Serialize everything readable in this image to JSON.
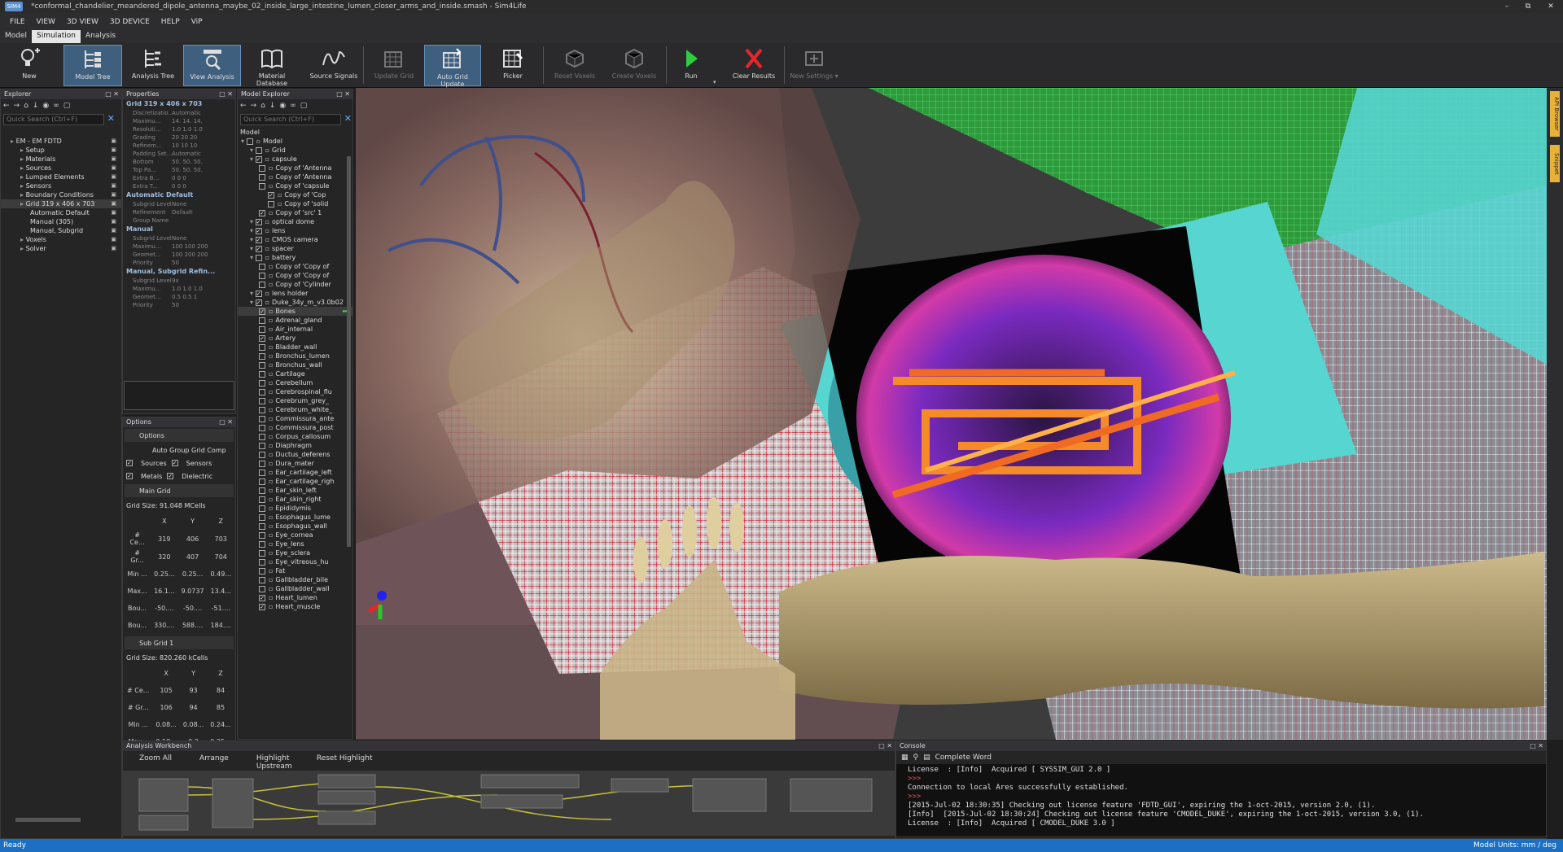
{
  "window": {
    "logo_text": "SIM4",
    "title": "*conformal_chandelier_meandered_dipole_antenna_maybe_02_inside_large_intestine_lumen_closer_arms_and_inside.smash - Sim4Life"
  },
  "menu": [
    "FILE",
    "VIEW",
    "3D VIEW",
    "3D DEVICE",
    "HELP",
    "ViP"
  ],
  "tabs": [
    "Model",
    "Simulation",
    "Analysis"
  ],
  "ribbon": {
    "new": "New",
    "model_tree": "Model Tree",
    "analysis_tree": "Analysis Tree",
    "view_analysis": "View Analysis",
    "material_database": "Material Database",
    "source_signals": "Source Signals",
    "update_grid": "Update Grid",
    "auto_grid_update": "Auto Grid Update",
    "picker": "Picker",
    "reset_voxels": "Reset Voxels",
    "create_voxels": "Create Voxels",
    "run": "Run",
    "clear_results": "Clear Results",
    "new_settings": "New Settings"
  },
  "explorer": {
    "title": "Explorer",
    "search_placeholder": "Quick Search (Ctrl+F)",
    "items": [
      {
        "label": "EM - EM FDTD",
        "indent": 0
      },
      {
        "label": "Setup",
        "indent": 1
      },
      {
        "label": "Materials",
        "indent": 1
      },
      {
        "label": "Sources",
        "indent": 1
      },
      {
        "label": "Lumped Elements",
        "indent": 1
      },
      {
        "label": "Sensors",
        "indent": 1
      },
      {
        "label": "Boundary Conditions",
        "indent": 1
      },
      {
        "label": "Grid 319 x 406 x 703",
        "indent": 1
      },
      {
        "label": "Automatic Default",
        "indent": 2
      },
      {
        "label": "Manual (305)",
        "indent": 2
      },
      {
        "label": "Manual, Subgrid",
        "indent": 2
      },
      {
        "label": "Voxels",
        "indent": 1
      },
      {
        "label": "Solver",
        "indent": 1
      }
    ]
  },
  "properties": {
    "title": "Properties",
    "header": "Grid 319 x 406 x 703",
    "rows1": [
      {
        "k": "Discretizatio...",
        "v": "Automatic"
      },
      {
        "k": "Maximu...",
        "v": "14.   14.   14."
      },
      {
        "k": "Resoluti...",
        "v": "1.0   1.0   1.0"
      },
      {
        "k": "Grading",
        "v": "20    20    20"
      },
      {
        "k": "Refinem...",
        "v": "10    10    10"
      },
      {
        "k": "Padding Set...",
        "v": "Automatic"
      },
      {
        "k": "Bottom",
        "v": "50.   50.   50."
      },
      {
        "k": "Top Pa...",
        "v": "50.   50.   50."
      },
      {
        "k": "Extra B...",
        "v": "0      0      0"
      },
      {
        "k": "Extra T...",
        "v": "0      0      0"
      }
    ],
    "sec2": "Automatic Default",
    "rows2": [
      {
        "k": "Subgrid Level",
        "v": "None"
      },
      {
        "k": "Refinement",
        "v": "Default"
      },
      {
        "k": "Group Name",
        "v": ""
      }
    ],
    "sec3": "Manual",
    "rows3": [
      {
        "k": "Subgrid Level",
        "v": "None"
      },
      {
        "k": "Maximu...",
        "v": "100   100   200"
      },
      {
        "k": "Geomet...",
        "v": "100   200   200"
      },
      {
        "k": "Priority",
        "v": "50"
      }
    ],
    "sec4": "Manual, Subgrid Refin...",
    "rows4": [
      {
        "k": "Subgrid Level",
        "v": "9x"
      },
      {
        "k": "Maximu...",
        "v": "1.0   1.0   1.0"
      },
      {
        "k": "Geomet...",
        "v": "0.5   0.5   1"
      },
      {
        "k": "Priority",
        "v": "50"
      }
    ]
  },
  "options": {
    "title": "Options",
    "header": "Options",
    "auto_group": "Auto Group Grid Comp",
    "sources": "Sources",
    "sensors": "Sensors",
    "metals": "Metals",
    "dielectric": "Dielectric",
    "main_grid": "Main Grid",
    "main_grid_size": "Grid Size: 91.048 MCells",
    "cols": [
      "X",
      "Y",
      "Z"
    ],
    "main_rows": [
      [
        "# Ce...",
        "319",
        "406",
        "703"
      ],
      [
        "# Gr...",
        "320",
        "407",
        "704"
      ],
      [
        "Min ...",
        "0.25...",
        "0.25...",
        "0.49..."
      ],
      [
        "Max...",
        "16.1...",
        "9.0737",
        "13.4..."
      ],
      [
        "Bou...",
        "-50....",
        "-50....",
        "-51...."
      ],
      [
        "Bou...",
        "330....",
        "588....",
        "184...."
      ]
    ],
    "sub_grid": "Sub Grid 1",
    "sub_grid_size": "Grid Size: 820.260 kCells",
    "sub_rows": [
      [
        "# Ce...",
        "105",
        "93",
        "84"
      ],
      [
        "# Gr...",
        "106",
        "94",
        "85"
      ],
      [
        "Min ...",
        "0.08...",
        "0.08...",
        "0.24..."
      ],
      [
        "Max...",
        "0.18...",
        "0.2",
        "0.25..."
      ]
    ]
  },
  "model_explorer": {
    "title": "Model Explorer",
    "search_placeholder": "Quick Search (Ctrl+F)",
    "root_label": "Model",
    "items": [
      {
        "label": "Model",
        "indent": 0,
        "checked": false
      },
      {
        "label": "Grid",
        "indent": 1,
        "checked": false
      },
      {
        "label": "capsule",
        "indent": 1,
        "checked": true
      },
      {
        "label": "Copy of 'Antenna",
        "indent": 2,
        "checked": false
      },
      {
        "label": "Copy of 'Antenna",
        "indent": 2,
        "checked": false
      },
      {
        "label": "Copy of 'capsule",
        "indent": 2,
        "checked": false
      },
      {
        "label": "Copy of 'Cop",
        "indent": 3,
        "checked": true
      },
      {
        "label": "Copy of 'solid",
        "indent": 3,
        "checked": false
      },
      {
        "label": "Copy of 'src' 1",
        "indent": 2,
        "checked": true
      },
      {
        "label": "optical dome",
        "indent": 1,
        "checked": true
      },
      {
        "label": "lens",
        "indent": 1,
        "checked": true
      },
      {
        "label": "CMOS camera",
        "indent": 1,
        "checked": true
      },
      {
        "label": "spacer",
        "indent": 1,
        "checked": true
      },
      {
        "label": "battery",
        "indent": 1,
        "checked": false
      },
      {
        "label": "Copy of 'Copy of",
        "indent": 2,
        "checked": false
      },
      {
        "label": "Copy of 'Copy of",
        "indent": 2,
        "checked": false
      },
      {
        "label": "Copy of 'Cylinder",
        "indent": 2,
        "checked": false
      },
      {
        "label": "lens holder",
        "indent": 1,
        "checked": true
      },
      {
        "label": "Duke_34y_m_v3.0b02",
        "indent": 1,
        "checked": true
      },
      {
        "label": "Bones",
        "indent": 2,
        "checked": true
      },
      {
        "label": "Adrenal_gland",
        "indent": 2,
        "checked": false
      },
      {
        "label": "Air_internal",
        "indent": 2,
        "checked": false
      },
      {
        "label": "Artery",
        "indent": 2,
        "checked": true
      },
      {
        "label": "Bladder_wall",
        "indent": 2,
        "checked": false
      },
      {
        "label": "Bronchus_lumen",
        "indent": 2,
        "checked": false
      },
      {
        "label": "Bronchus_wall",
        "indent": 2,
        "checked": false
      },
      {
        "label": "Cartilage",
        "indent": 2,
        "checked": false
      },
      {
        "label": "Cerebellum",
        "indent": 2,
        "checked": false
      },
      {
        "label": "Cerebrospinal_flu",
        "indent": 2,
        "checked": false
      },
      {
        "label": "Cerebrum_grey_",
        "indent": 2,
        "checked": false
      },
      {
        "label": "Cerebrum_white_",
        "indent": 2,
        "checked": false
      },
      {
        "label": "Commissura_ante",
        "indent": 2,
        "checked": false
      },
      {
        "label": "Commissura_post",
        "indent": 2,
        "checked": false
      },
      {
        "label": "Corpus_callosum",
        "indent": 2,
        "checked": false
      },
      {
        "label": "Diaphragm",
        "indent": 2,
        "checked": false
      },
      {
        "label": "Ductus_deferens",
        "indent": 2,
        "checked": false
      },
      {
        "label": "Dura_mater",
        "indent": 2,
        "checked": false
      },
      {
        "label": "Ear_cartilage_left",
        "indent": 2,
        "checked": false
      },
      {
        "label": "Ear_cartilage_righ",
        "indent": 2,
        "checked": false
      },
      {
        "label": "Ear_skin_left",
        "indent": 2,
        "checked": false
      },
      {
        "label": "Ear_skin_right",
        "indent": 2,
        "checked": false
      },
      {
        "label": "Epididymis",
        "indent": 2,
        "checked": false
      },
      {
        "label": "Esophagus_lume",
        "indent": 2,
        "checked": false
      },
      {
        "label": "Esophagus_wall",
        "indent": 2,
        "checked": false
      },
      {
        "label": "Eye_cornea",
        "indent": 2,
        "checked": false
      },
      {
        "label": "Eye_lens",
        "indent": 2,
        "checked": false
      },
      {
        "label": "Eye_sclera",
        "indent": 2,
        "checked": false
      },
      {
        "label": "Eye_vitreous_hu",
        "indent": 2,
        "checked": false
      },
      {
        "label": "Fat",
        "indent": 2,
        "checked": false
      },
      {
        "label": "Gallbladder_bile",
        "indent": 2,
        "checked": false
      },
      {
        "label": "Gallbladder_wall",
        "indent": 2,
        "checked": false
      },
      {
        "label": "Heart_lumen",
        "indent": 2,
        "checked": true
      },
      {
        "label": "Heart_muscle",
        "indent": 2,
        "checked": true
      }
    ]
  },
  "right_strip": [
    "API Browser",
    "Snippet"
  ],
  "workbench": {
    "title": "Analysis Workbench",
    "buttons": [
      "Zoom All",
      "Arrange",
      "Highlight Upstream",
      "Reset Highlight"
    ]
  },
  "console": {
    "title": "Console",
    "complete_word": "Complete Word",
    "lines": [
      {
        "t": "License  : [Info]  Acquired [ SYSSIM_GUI 2.0 ]",
        "red": false
      },
      {
        "t": ">>>",
        "red": true
      },
      {
        "t": "Connection to local Ares successfully established.",
        "red": false
      },
      {
        "t": ">>>",
        "red": true
      },
      {
        "t": "[2015-Jul-02 18:30:35] Checking out license feature 'FDTD_GUI', expiring the 1-oct-2015, version 2.0, (1).",
        "red": false
      },
      {
        "t": "[Info]  [2015-Jul-02 18:30:24] Checking out license feature 'CMODEL_DUKE', expiring the 1-oct-2015, version 3.0, (1).",
        "red": false
      },
      {
        "t": "License  : [Info]  Acquired [ CMODEL_DUKE 3.0 ]",
        "red": false
      }
    ]
  },
  "status": {
    "left": "Ready",
    "right": "Model Units: mm / deg"
  }
}
